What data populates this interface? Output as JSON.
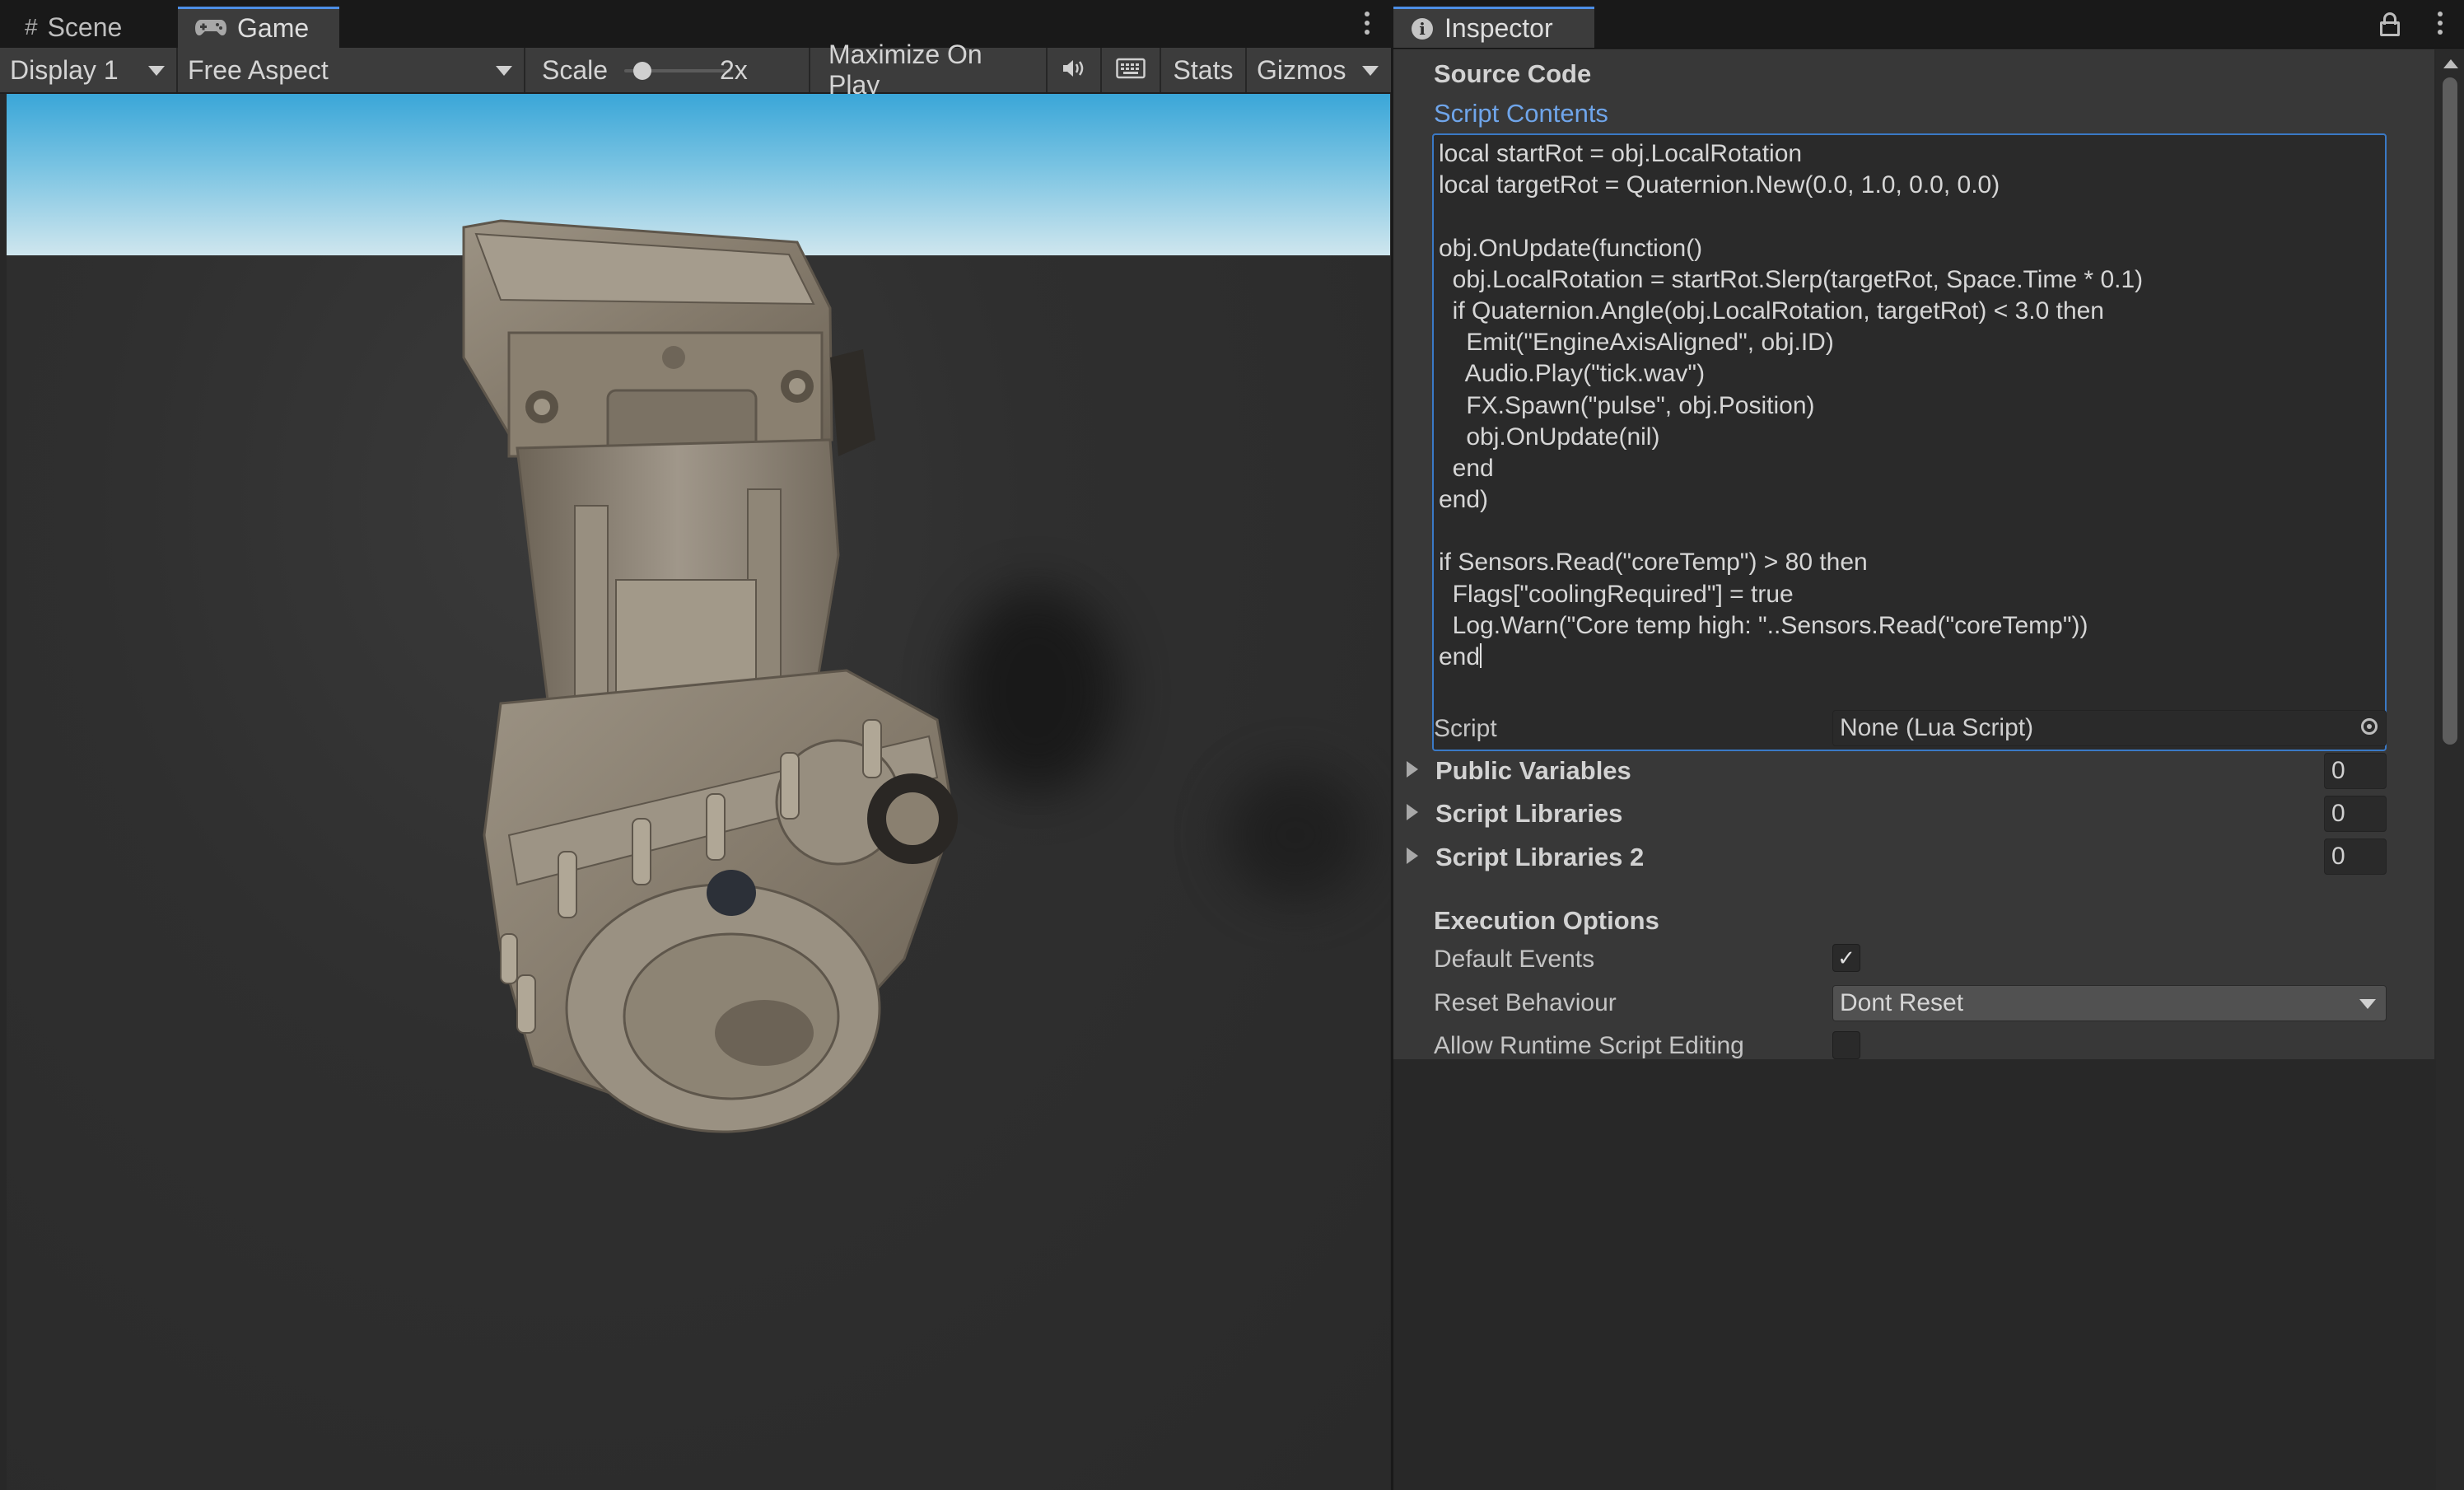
{
  "game_tabs": {
    "scene_label": "Scene",
    "game_label": "Game"
  },
  "game_toolbar": {
    "display": "Display 1",
    "aspect": "Free Aspect",
    "scale_label": "Scale",
    "scale_value": "2x",
    "scale_slider_fraction": 0.1,
    "maximize_on_play": "Maximize On Play",
    "stats": "Stats",
    "gizmos": "Gizmos"
  },
  "inspector": {
    "tab_label": "Inspector",
    "source_code_header": "Source Code",
    "script_contents_label": "Script Contents",
    "code_lines": [
      "local startRot = obj.LocalRotation",
      "local targetRot = Quaternion.New(0.0, 1.0, 0.0, 0.0)",
      "",
      "obj.OnUpdate(function()",
      "  obj.LocalRotation = startRot.Slerp(targetRot, Space.Time * 0.1)",
      "  if Quaternion.Angle(obj.LocalRotation, targetRot) < 3.0 then",
      "    Emit(\"EngineAxisAligned\", obj.ID)",
      "    Audio.Play(\"tick.wav\")",
      "    FX.Spawn(\"pulse\", obj.Position)",
      "    obj.OnUpdate(nil)",
      "  end",
      "end)",
      "",
      "if Sensors.Read(\"coreTemp\") > 80 then",
      "  Flags[\"coolingRequired\"] = true",
      "  Log.Warn(\"Core temp high: \"..Sensors.Read(\"coreTemp\"))",
      "end"
    ],
    "script_label": "Script",
    "script_value": "None (Lua Script)",
    "public_variables_label": "Public Variables",
    "public_variables_count": "0",
    "script_libraries_label": "Script Libraries",
    "script_libraries_count": "0",
    "script_libraries2_label": "Script Libraries 2",
    "script_libraries2_count": "0",
    "execution_options_header": "Execution Options",
    "default_events_label": "Default Events",
    "default_events_checked": true,
    "reset_behaviour_label": "Reset Behaviour",
    "reset_behaviour_value": "Dont Reset",
    "allow_runtime_label": "Allow Runtime Script Editing",
    "allow_runtime_checked": false
  },
  "colors": {
    "accent": "#4d8ee6",
    "link": "#6fa5ea",
    "panel": "#383838",
    "engine": "#8a8070"
  }
}
